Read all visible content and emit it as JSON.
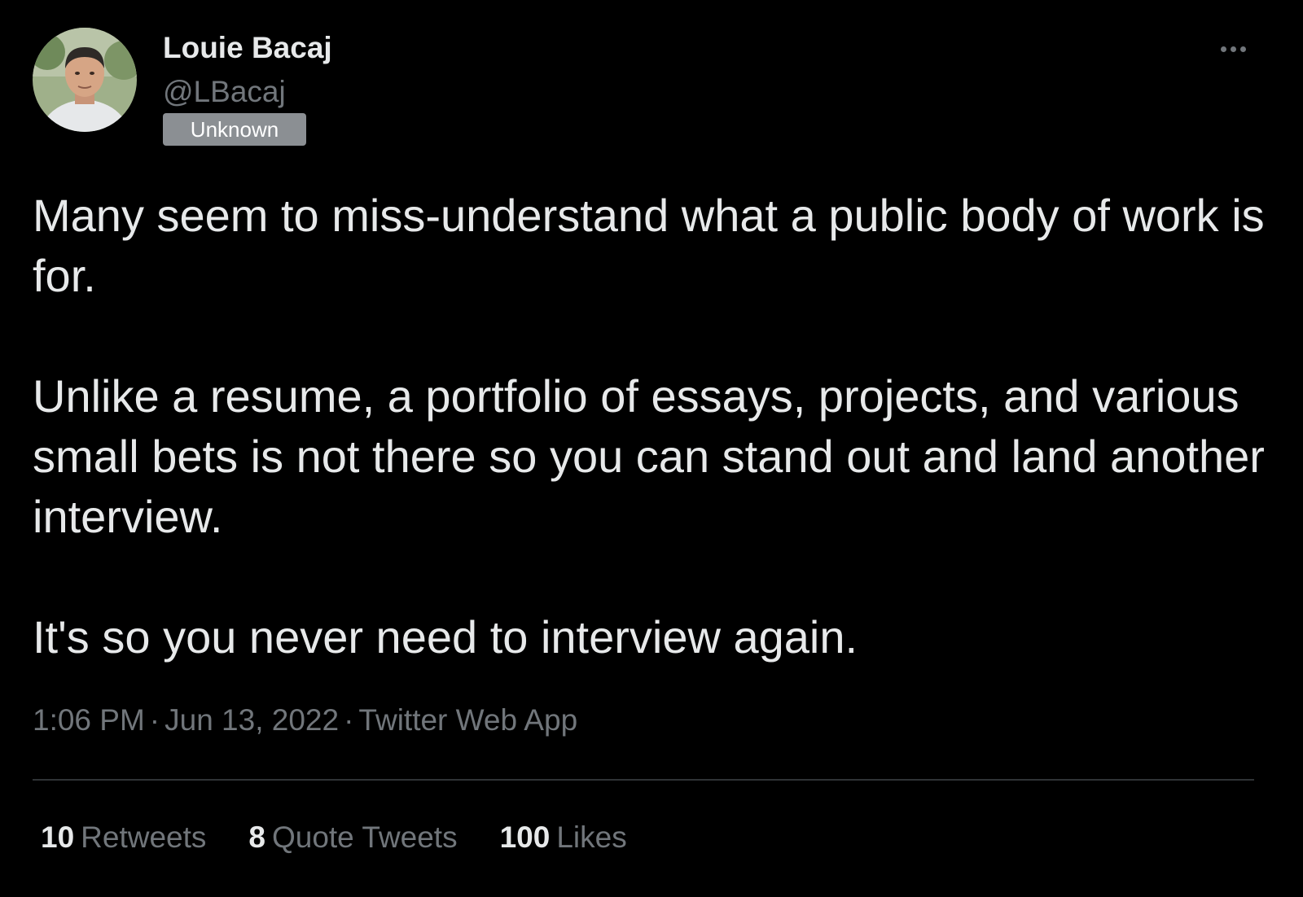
{
  "author": {
    "display_name": "Louie Bacaj",
    "handle": "@LBacaj",
    "badge": "Unknown",
    "avatar_icon": "profile-photo"
  },
  "more_icon": "more-horizontal-icon",
  "tweet": {
    "paragraphs": [
      "Many seem to miss-understand what a public body of work is for.",
      "Unlike a resume, a portfolio of essays, projects, and various small bets is not there so you can stand out and land another interview.",
      "It's so you never need to interview again."
    ],
    "time": "1:06 PM",
    "date": "Jun 13, 2022",
    "separator": "·",
    "source": "Twitter Web App"
  },
  "stats": {
    "retweets": {
      "count": "10",
      "label": "Retweets"
    },
    "quote_tweets": {
      "count": "8",
      "label": "Quote Tweets"
    },
    "likes": {
      "count": "100",
      "label": "Likes"
    }
  },
  "colors": {
    "background": "#000000",
    "primary_text": "#e7e9ea",
    "secondary_text": "#71767b",
    "badge_background": "#8b8f93",
    "divider": "#2f3336"
  }
}
